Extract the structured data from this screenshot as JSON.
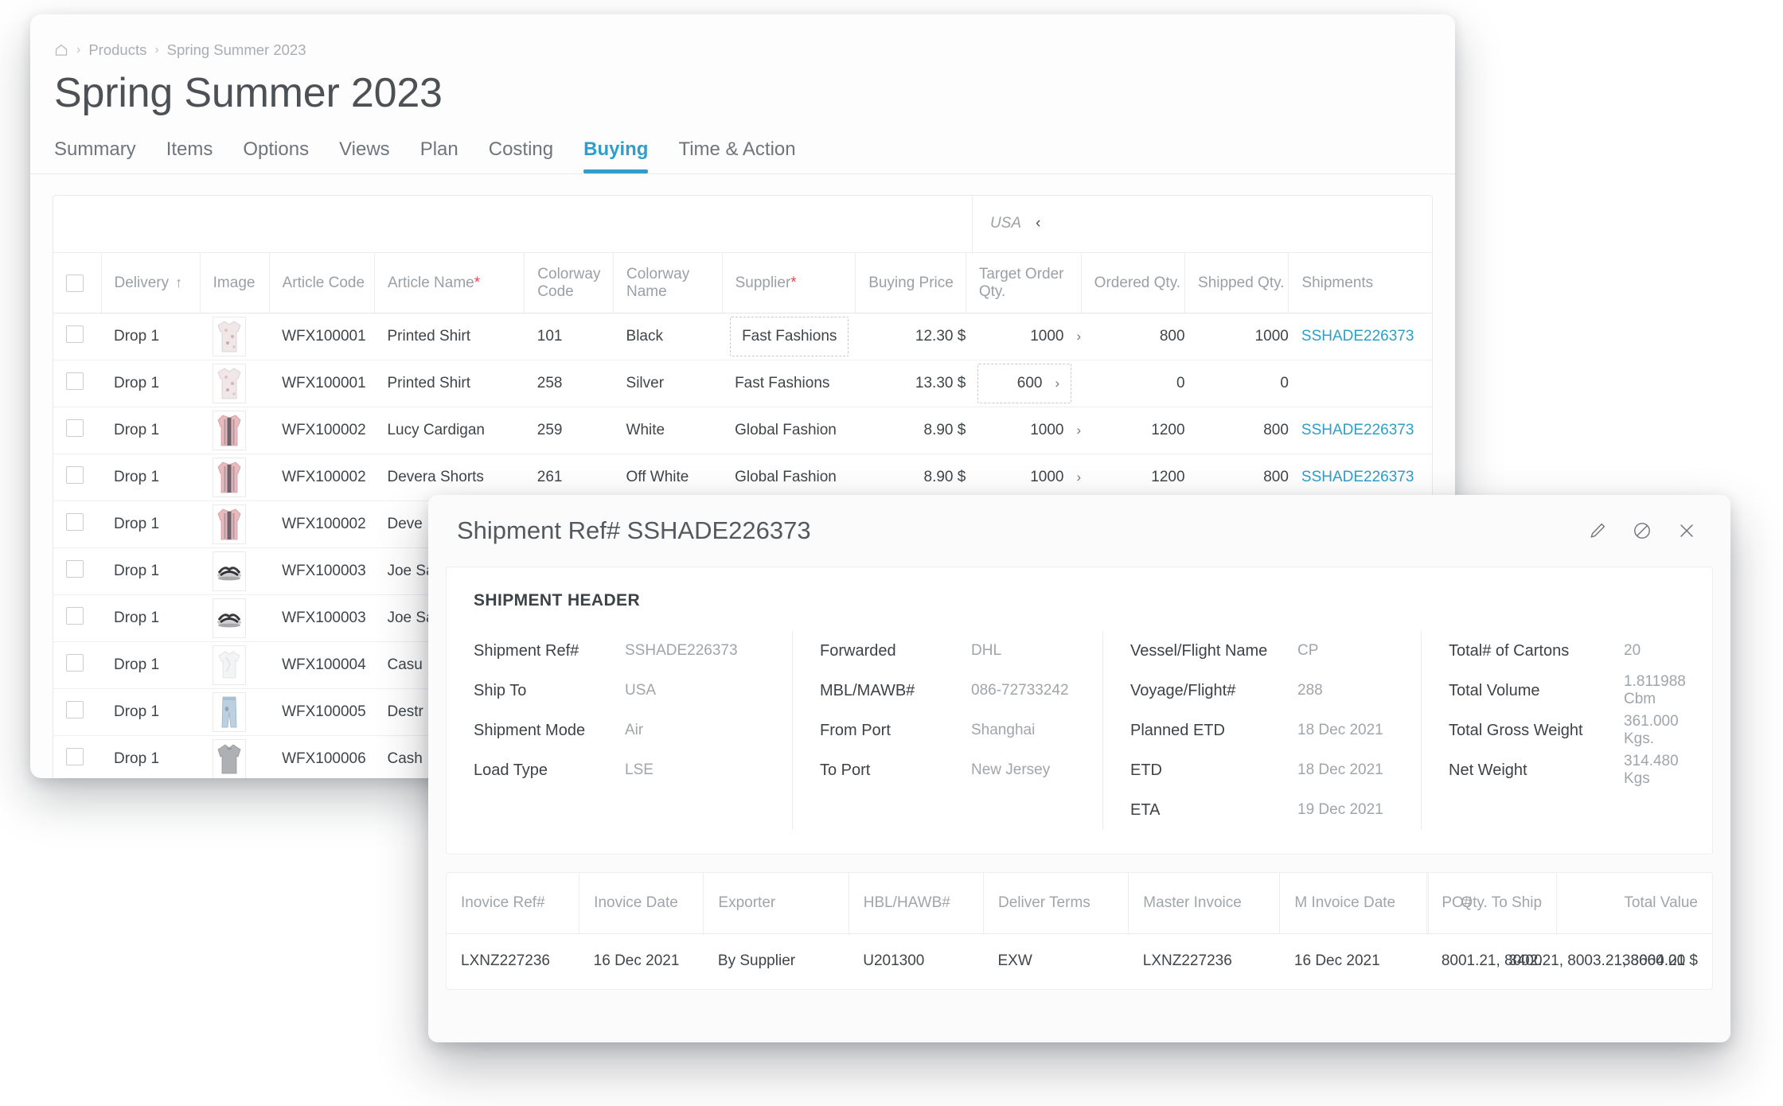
{
  "breadcrumb": {
    "home_icon": "home-icon",
    "items": [
      "Products",
      "Spring Summer 2023"
    ],
    "separator": "›"
  },
  "page_title": "Spring Summer 2023",
  "tabs": [
    {
      "label": "Summary",
      "active": false
    },
    {
      "label": "Items",
      "active": false
    },
    {
      "label": "Options",
      "active": false
    },
    {
      "label": "Views",
      "active": false
    },
    {
      "label": "Plan",
      "active": false
    },
    {
      "label": "Costing",
      "active": false
    },
    {
      "label": "Buying",
      "active": true
    },
    {
      "label": "Time & Action",
      "active": false
    }
  ],
  "grid": {
    "filter_label": "USA",
    "filter_chevron": "‹",
    "sort_arrow": "↑",
    "columns": [
      {
        "key": "checkbox",
        "label": ""
      },
      {
        "key": "delivery",
        "label": "Delivery",
        "sorted": true
      },
      {
        "key": "image",
        "label": "Image"
      },
      {
        "key": "article_code",
        "label": "Article Code"
      },
      {
        "key": "article_name",
        "label": "Article Name",
        "required": true
      },
      {
        "key": "colorway_code",
        "label": "Colorway Code"
      },
      {
        "key": "colorway_name",
        "label": "Colorway Name"
      },
      {
        "key": "supplier",
        "label": "Supplier",
        "required": true
      },
      {
        "key": "buying_price",
        "label": "Buying Price"
      },
      {
        "key": "target_order_qty",
        "label": "Target Order Qty."
      },
      {
        "key": "ordered_qty",
        "label": "Ordered Qty."
      },
      {
        "key": "shipped_qty",
        "label": "Shipped Qty."
      },
      {
        "key": "shipments",
        "label": "Shipments"
      }
    ],
    "rows": [
      {
        "delivery": "Drop 1",
        "image": "printed-shirt",
        "article_code": "WFX100001",
        "article_name": "Printed Shirt",
        "colorway_code": "101",
        "colorway_name": "Black",
        "supplier": "Fast Fashions",
        "supplier_focus": true,
        "buying_price": "12.30 $",
        "target_order_qty": "1000",
        "target_focus": false,
        "ordered_qty": "800",
        "ordered_color": "blue",
        "shipped_qty": "1000",
        "shipped_color": "red",
        "shipments": "SSHADE226373"
      },
      {
        "delivery": "Drop 1",
        "image": "printed-shirt",
        "article_code": "WFX100001",
        "article_name": "Printed Shirt",
        "colorway_code": "258",
        "colorway_name": "Silver",
        "supplier": "Fast Fashions",
        "supplier_focus": false,
        "buying_price": "13.30 $",
        "target_order_qty": "600",
        "target_focus": true,
        "ordered_qty": "0",
        "ordered_color": "blue",
        "shipped_qty": "0",
        "shipped_color": "blue",
        "shipments": ""
      },
      {
        "delivery": "Drop 1",
        "image": "cardigan",
        "article_code": "WFX100002",
        "article_name": "Lucy Cardigan",
        "colorway_code": "259",
        "colorway_name": "White",
        "supplier": "Global Fashion",
        "supplier_focus": false,
        "buying_price": "8.90 $",
        "target_order_qty": "1000",
        "target_focus": false,
        "ordered_qty": "1200",
        "ordered_color": "red",
        "shipped_qty": "800",
        "shipped_color": "blue",
        "shipments": "SSHADE226373"
      },
      {
        "delivery": "Drop 1",
        "image": "cardigan",
        "article_code": "WFX100002",
        "article_name": "Devera Shorts",
        "colorway_code": "261",
        "colorway_name": "Off White",
        "supplier": "Global Fashion",
        "supplier_focus": false,
        "buying_price": "8.90 $",
        "target_order_qty": "1000",
        "target_focus": false,
        "ordered_qty": "1200",
        "ordered_color": "red",
        "shipped_qty": "800",
        "shipped_color": "blue",
        "shipments": "SSHADE226373"
      },
      {
        "delivery": "Drop 1",
        "image": "cardigan",
        "article_code": "WFX100002",
        "article_name": "Deve",
        "colorway_code": "",
        "colorway_name": "",
        "supplier": "",
        "buying_price": "",
        "target_order_qty": "",
        "ordered_qty": "",
        "shipped_qty": "",
        "shipments": ""
      },
      {
        "delivery": "Drop 1",
        "image": "sandal",
        "article_code": "WFX100003",
        "article_name": "Joe Sa",
        "colorway_code": "",
        "colorway_name": "",
        "supplier": "",
        "buying_price": "",
        "target_order_qty": "",
        "ordered_qty": "",
        "shipped_qty": "",
        "shipments": ""
      },
      {
        "delivery": "Drop 1",
        "image": "sandal",
        "article_code": "WFX100003",
        "article_name": "Joe Sa",
        "colorway_code": "",
        "colorway_name": "",
        "supplier": "",
        "buying_price": "",
        "target_order_qty": "",
        "ordered_qty": "",
        "shipped_qty": "",
        "shipments": ""
      },
      {
        "delivery": "Drop 1",
        "image": "tshirt",
        "article_code": "WFX100004",
        "article_name": "Casu",
        "colorway_code": "",
        "colorway_name": "",
        "supplier": "",
        "buying_price": "",
        "target_order_qty": "",
        "ordered_qty": "",
        "shipped_qty": "",
        "shipments": ""
      },
      {
        "delivery": "Drop 1",
        "image": "jeans",
        "article_code": "WFX100005",
        "article_name": "Destr",
        "colorway_code": "",
        "colorway_name": "",
        "supplier": "",
        "buying_price": "",
        "target_order_qty": "",
        "ordered_qty": "",
        "shipped_qty": "",
        "shipments": ""
      },
      {
        "delivery": "Drop 1",
        "image": "sweater",
        "article_code": "WFX100006",
        "article_name": "Cash",
        "colorway_code": "",
        "colorway_name": "",
        "supplier": "",
        "buying_price": "",
        "target_order_qty": "",
        "ordered_qty": "",
        "shipped_qty": "",
        "shipments": ""
      }
    ]
  },
  "modal": {
    "title": "Shipment Ref# SSHADE226373",
    "actions": [
      {
        "icon": "pencil-icon",
        "name": "edit"
      },
      {
        "icon": "circle-slash-icon",
        "name": "cancel"
      },
      {
        "icon": "close-icon",
        "name": "close"
      }
    ],
    "header_section_title": "SHIPMENT HEADER",
    "columns": [
      [
        {
          "label": "Shipment Ref#",
          "value": "SSHADE226373"
        },
        {
          "label": "Ship To",
          "value": "USA"
        },
        {
          "label": "Shipment Mode",
          "value": "Air"
        },
        {
          "label": "Load Type",
          "value": "LSE"
        }
      ],
      [
        {
          "label": "Forwarded",
          "value": "DHL"
        },
        {
          "label": "MBL/MAWB#",
          "value": "086-72733242"
        },
        {
          "label": "From Port",
          "value": "Shanghai"
        },
        {
          "label": "To Port",
          "value": "New Jersey"
        }
      ],
      [
        {
          "label": "Vessel/Flight Name",
          "value": "CP"
        },
        {
          "label": "Voyage/Flight#",
          "value": "288"
        },
        {
          "label": "Planned ETD",
          "value": "18 Dec 2021"
        },
        {
          "label": "ETD",
          "value": "18 Dec 2021"
        },
        {
          "label": "ETA",
          "value": "19 Dec 2021"
        }
      ],
      [
        {
          "label": "Total# of Cartons",
          "value": "20"
        },
        {
          "label": "Total Volume",
          "value": "1.811988 Cbm"
        },
        {
          "label": "Total Gross Weight",
          "value": "361.000 Kgs."
        },
        {
          "label": "Net Weight",
          "value": "314.480 Kgs"
        }
      ]
    ],
    "invoice_table": {
      "columns": [
        {
          "label": "Inovice Ref#",
          "align": "left"
        },
        {
          "label": "Inovice Date",
          "align": "left"
        },
        {
          "label": "Exporter",
          "align": "left"
        },
        {
          "label": "HBL/HAWB#",
          "align": "left"
        },
        {
          "label": "Deliver Terms",
          "align": "left"
        },
        {
          "label": "Master Invoice",
          "align": "left"
        },
        {
          "label": "M Invoice Date",
          "align": "left"
        },
        {
          "label": "PO#",
          "align": "left"
        },
        {
          "label": "Qty. To Ship",
          "align": "right"
        },
        {
          "label": "Total Value",
          "align": "right"
        }
      ],
      "rows": [
        {
          "invoice_ref": "LXNZ227236",
          "invoice_date": "16 Dec 2021",
          "exporter": "By Supplier",
          "hbl_hawb": "U201300",
          "deliver_terms": "EXW",
          "master_invoice": "LXNZ227236",
          "m_invoice_date": "16 Dec 2021",
          "po": "8001.21, 8002.21, 8003.21, 8004.21",
          "qty_to_ship": "3400",
          "total_value": "33660.00 $"
        }
      ]
    }
  },
  "colors": {
    "accent": "#2e9ecb",
    "danger": "#e8474b",
    "text": "#3f4549",
    "muted": "#a0a5aa"
  }
}
